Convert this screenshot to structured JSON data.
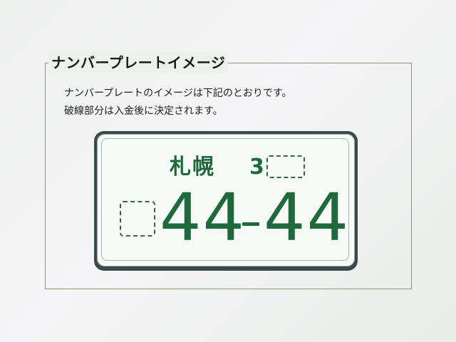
{
  "section": {
    "title": "ナンバープレートイメージ",
    "description_line1": "ナンバープレートのイメージは下記のとおりです。",
    "description_line2": "破線部分は入金後に決定されます。"
  },
  "plate": {
    "region": "札幌",
    "class_digit": "3",
    "number_left": "44",
    "number_right": "44",
    "number_separator": "-",
    "text_color": "#1f6a3c",
    "background_color": "#f7f9f7"
  }
}
